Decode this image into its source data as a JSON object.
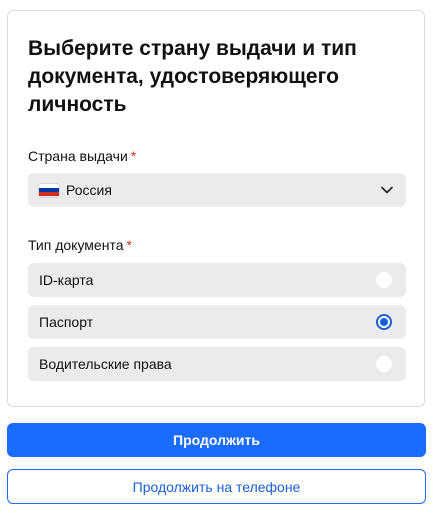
{
  "form": {
    "title": "Выберите страну выдачи и тип документа, удостоверяющего личность",
    "country": {
      "label": "Страна выдачи",
      "required_mark": "*",
      "selected": "Россия",
      "flag_colors": [
        "#ffffff",
        "#0039a6",
        "#d52b1e"
      ]
    },
    "document_type": {
      "label": "Тип документа",
      "required_mark": "*",
      "options": [
        {
          "label": "ID-карта",
          "selected": false
        },
        {
          "label": "Паспорт",
          "selected": true
        },
        {
          "label": "Водительские права",
          "selected": false
        }
      ]
    }
  },
  "actions": {
    "continue_label": "Продолжить",
    "continue_on_phone_label": "Продолжить на телефоне"
  },
  "colors": {
    "accent": "#1a6bff",
    "radio_selected": "#1a5fd6",
    "required": "#d93025",
    "field_background": "#ebebeb"
  },
  "icons": {
    "country_flag": "russia-flag-icon",
    "dropdown": "chevron-down-icon",
    "radio": "radio-icon"
  }
}
